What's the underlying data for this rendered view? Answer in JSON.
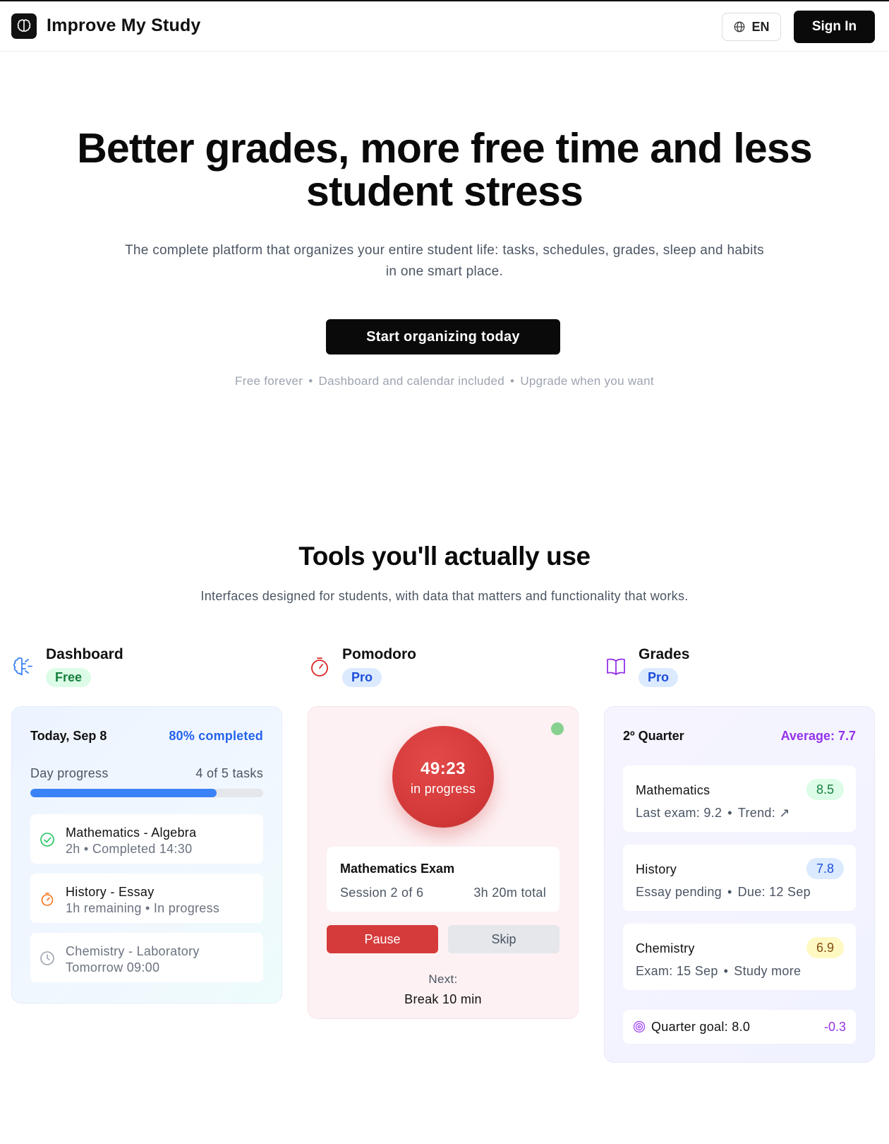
{
  "header": {
    "brand": "Improve My Study",
    "language": "EN",
    "sign_in": "Sign In"
  },
  "hero": {
    "title": "Better grades, more free time and less student stress",
    "subtitle": "The complete platform that organizes your entire student life: tasks, schedules, grades, sleep and habits in one smart place.",
    "cta": "Start organizing today",
    "notes": [
      "Free forever",
      "Dashboard and calendar included",
      "Upgrade when you want"
    ],
    "separator": "•"
  },
  "tools_section": {
    "title": "Tools you'll actually use",
    "subtitle": "Interfaces designed for students, with data that matters and functionality that works."
  },
  "dashboard": {
    "name": "Dashboard",
    "badge": "Free",
    "date": "Today, Sep 8",
    "completed": "80% completed",
    "progress_label": "Day progress",
    "progress_count": "4 of 5 tasks",
    "progress_fraction": 0.8,
    "tasks": [
      {
        "title": "Mathematics - Algebra",
        "meta": "2h • Completed 14:30",
        "icon": "check-circle-icon",
        "status": "done"
      },
      {
        "title": "History - Essay",
        "meta": "1h remaining • In progress",
        "icon": "timer-icon",
        "status": "in-progress"
      },
      {
        "title": "Chemistry - Laboratory",
        "meta": "Tomorrow 09:00",
        "icon": "clock-icon",
        "status": "upcoming"
      }
    ]
  },
  "pomodoro": {
    "name": "Pomodoro",
    "badge": "Pro",
    "time": "49:23",
    "status": "in progress",
    "session_title": "Mathematics Exam",
    "session_count": "Session 2 of 6",
    "session_total": "3h 20m total",
    "pause": "Pause",
    "skip": "Skip",
    "next_label": "Next:",
    "next_value": "Break 10 min"
  },
  "grades": {
    "name": "Grades",
    "badge": "Pro",
    "quarter": "2º Quarter",
    "average": "Average: 7.7",
    "subjects": [
      {
        "name": "Mathematics",
        "grade": "8.5",
        "meta_a": "Last exam: 9.2",
        "meta_b": "Trend: ↗",
        "color": "green"
      },
      {
        "name": "History",
        "grade": "7.8",
        "meta_a": "Essay pending",
        "meta_b": "Due: 12 Sep",
        "color": "blue"
      },
      {
        "name": "Chemistry",
        "grade": "6.9",
        "meta_a": "Exam: 15 Sep",
        "meta_b": "Study more",
        "color": "yellow"
      }
    ],
    "goal": "Quarter goal: 8.0",
    "goal_diff": "-0.3"
  },
  "colors": {
    "accent_blue": "#2563eb",
    "pomodoro_red": "#d63b3b",
    "grades_purple": "#9333ea",
    "free_badge": "#15803d"
  }
}
